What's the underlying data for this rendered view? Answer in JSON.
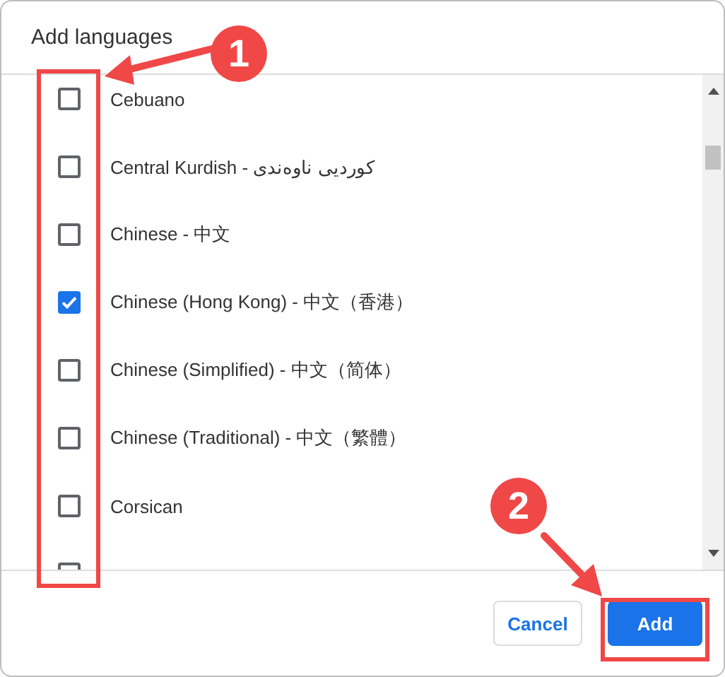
{
  "dialog": {
    "title": "Add languages"
  },
  "languages": [
    {
      "label": "Cebuano",
      "checked": false
    },
    {
      "label": "Central Kurdish - کوردیی ناوەندی",
      "checked": false
    },
    {
      "label": "Chinese - 中文",
      "checked": false
    },
    {
      "label": "Chinese (Hong Kong) - 中文（香港）",
      "checked": true
    },
    {
      "label": "Chinese (Simplified) - 中文（简体）",
      "checked": false
    },
    {
      "label": "Chinese (Traditional) - 中文（繁體）",
      "checked": false
    },
    {
      "label": "Corsican",
      "checked": false
    },
    {
      "checked": false
    }
  ],
  "buttons": [
    {
      "label": "Cancel",
      "kind": "secondary"
    },
    {
      "label": "Add",
      "kind": "primary"
    }
  ],
  "annotations": [
    {
      "label": "1"
    },
    {
      "label": "2"
    }
  ]
}
